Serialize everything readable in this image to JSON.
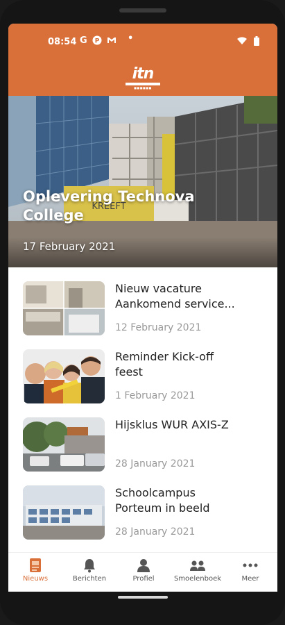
{
  "status": {
    "time": "08:54",
    "icons": [
      "G",
      "P",
      "M",
      "dot",
      "wifi",
      "battery"
    ]
  },
  "header": {
    "logo_text": "itn"
  },
  "hero": {
    "title": "Oplevering Technova College",
    "date": "17 February 2021",
    "sign": "KREEFT"
  },
  "news": [
    {
      "title_line1": "Nieuw vacature",
      "title_line2": "Aankomend service...",
      "date": "12 February 2021"
    },
    {
      "title_line1": "Reminder Kick-off",
      "title_line2": "feest",
      "date": "1 February 2021"
    },
    {
      "title_line1": "Hijsklus WUR AXIS-Z",
      "title_line2": "",
      "date": "28 January 2021"
    },
    {
      "title_line1": "Schoolcampus",
      "title_line2": "Porteum in beeld",
      "date": "28 January 2021"
    }
  ],
  "tabs": [
    {
      "label": "Nieuws",
      "icon": "news-icon",
      "active": true
    },
    {
      "label": "Berichten",
      "icon": "bell-icon",
      "active": false
    },
    {
      "label": "Profiel",
      "icon": "person-icon",
      "active": false
    },
    {
      "label": "Smoelenboek",
      "icon": "people-icon",
      "active": false
    },
    {
      "label": "Meer",
      "icon": "more-dots-icon",
      "active": false
    }
  ],
  "colors": {
    "brand": "#d9703a",
    "text": "#222222",
    "muted": "#999999"
  }
}
